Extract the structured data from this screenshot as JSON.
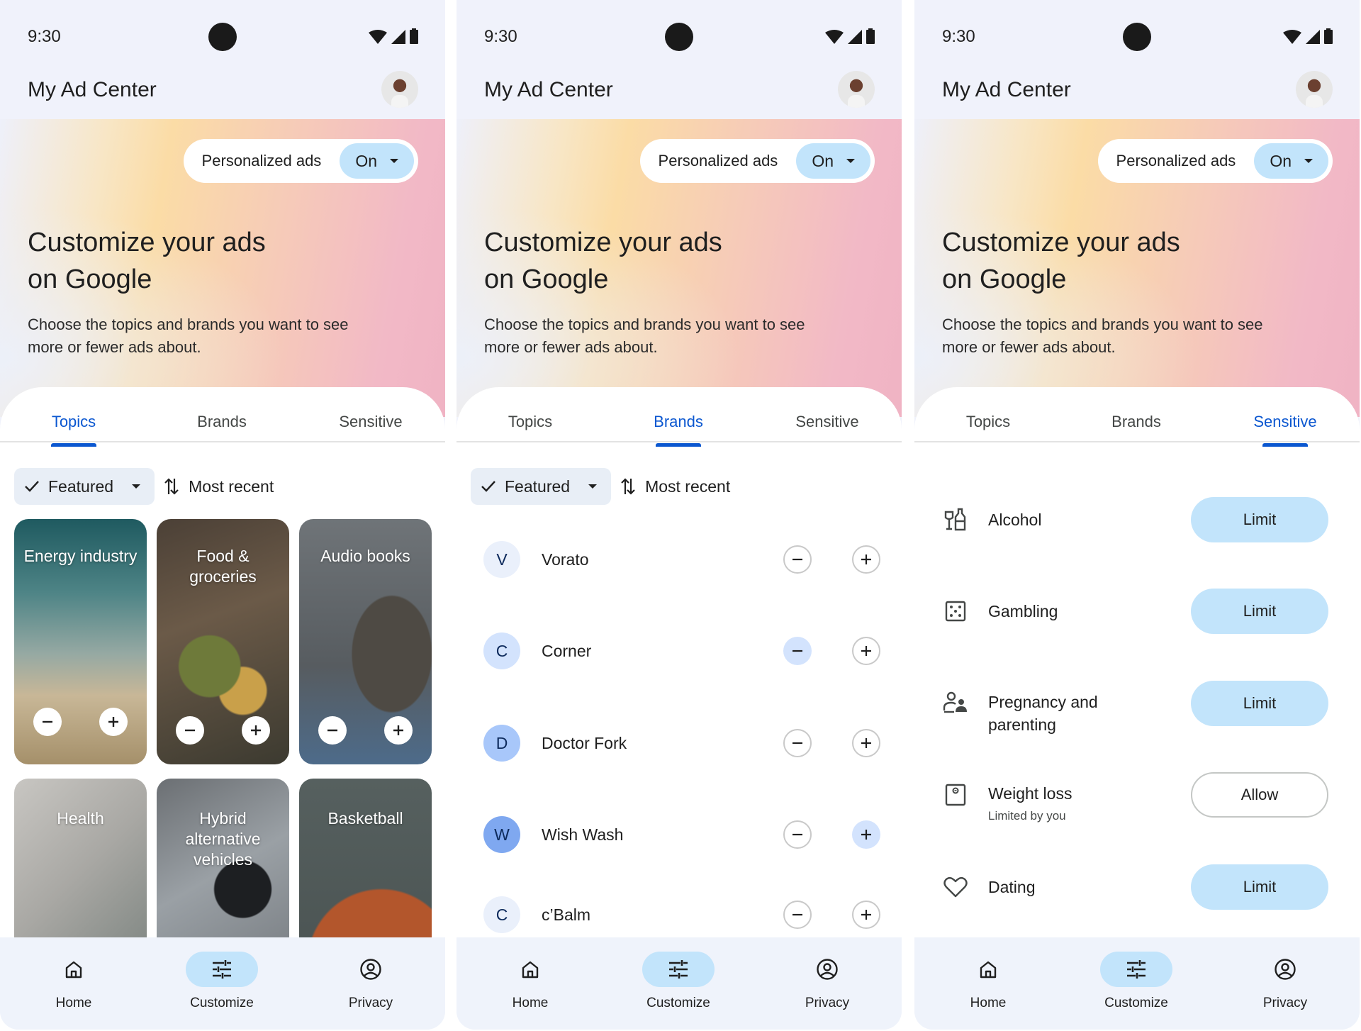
{
  "status_bar": {
    "time": "9:30",
    "icons": [
      "wifi-icon",
      "cellular-signal-icon",
      "battery-icon"
    ]
  },
  "app_title": "My Ad Center",
  "personalized_ads": {
    "label": "Personalized ads",
    "value": "On"
  },
  "hero": {
    "heading_line1": "Customize your ads",
    "heading_line2": "on Google",
    "description": "Choose the topics and brands you want to see more or fewer ads about."
  },
  "tabs": [
    "Topics",
    "Brands",
    "Sensitive"
  ],
  "filters": {
    "featured_label": "Featured",
    "sort_label": "Most recent"
  },
  "bottom_nav": [
    "Home",
    "Customize",
    "Privacy"
  ],
  "screens": [
    {
      "active_tab": "Topics",
      "topics": [
        {
          "name": "Energy industry"
        },
        {
          "name": "Food & groceries"
        },
        {
          "name": "Audio books"
        },
        {
          "name": "Health"
        },
        {
          "name": "Hybrid alternative vehicles"
        },
        {
          "name": "Basketball"
        }
      ]
    },
    {
      "active_tab": "Brands",
      "brands": [
        {
          "initial": "V",
          "name": "Vorato",
          "state": "none"
        },
        {
          "initial": "C",
          "name": "Corner",
          "state": "fewer"
        },
        {
          "initial": "D",
          "name": "Doctor Fork",
          "state": "none"
        },
        {
          "initial": "W",
          "name": "Wish Wash",
          "state": "more"
        },
        {
          "initial": "C",
          "name": "c’Balm",
          "state": "none"
        }
      ]
    },
    {
      "active_tab": "Sensitive",
      "sensitive": [
        {
          "icon": "alcohol-icon",
          "name": "Alcohol",
          "sub": "",
          "action": "Limit"
        },
        {
          "icon": "dice-icon",
          "name": "Gambling",
          "sub": "",
          "action": "Limit"
        },
        {
          "icon": "parenting-icon",
          "name": "Pregnancy and parenting",
          "sub": "",
          "action": "Limit"
        },
        {
          "icon": "scale-icon",
          "name": "Weight loss",
          "sub": "Limited by you",
          "action": "Allow"
        },
        {
          "icon": "heart-icon",
          "name": "Dating",
          "sub": "",
          "action": "Limit"
        }
      ]
    }
  ],
  "colors": {
    "accent": "#0b57d0",
    "tonal": "#c2e4fb",
    "surface": "#f0f2fb"
  }
}
